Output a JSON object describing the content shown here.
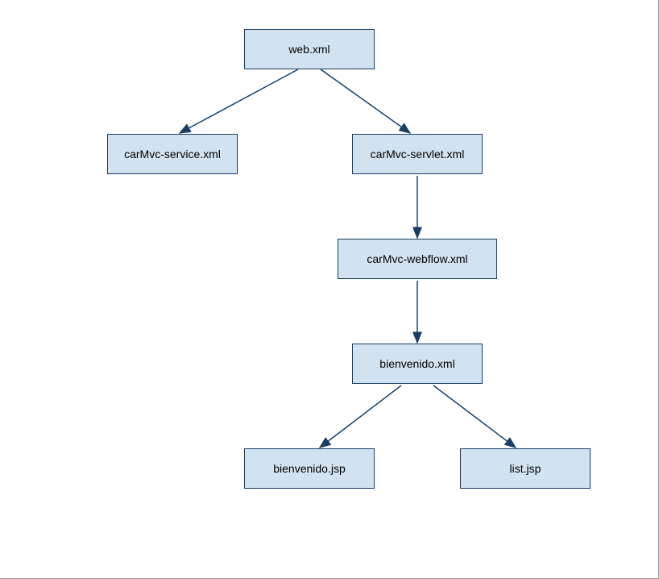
{
  "nodes": {
    "web": "web.xml",
    "service": "carMvc-service.xml",
    "servlet": "carMvc-servlet.xml",
    "webflow": "carMvc-webflow.xml",
    "bienvenido_xml": "bienvenido.xml",
    "bienvenido_jsp": "bienvenido.jsp",
    "list_jsp": "list.jsp"
  }
}
